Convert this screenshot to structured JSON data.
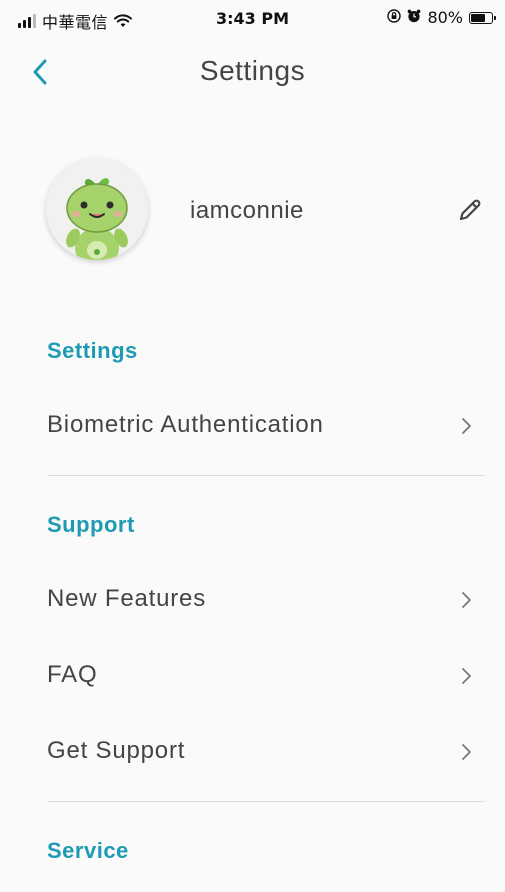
{
  "status_bar": {
    "carrier": "中華電信",
    "time": "3:43 PM",
    "battery_percent": "80%",
    "battery_level": 0.8,
    "icons": [
      "signal-icon",
      "wifi-icon",
      "orientation-lock-icon",
      "alarm-icon",
      "battery-icon"
    ]
  },
  "nav": {
    "title": "Settings",
    "back_icon": "chevron-left-icon"
  },
  "profile": {
    "username": "iamconnie",
    "avatar_icon": "green-mascot-avatar",
    "edit_icon": "pencil-icon"
  },
  "sections": {
    "settings": {
      "title": "Settings",
      "items": [
        {
          "label": "Biometric Authentication",
          "icon": "chevron-right-icon"
        }
      ]
    },
    "support": {
      "title": "Support",
      "items": [
        {
          "label": "New Features",
          "icon": "chevron-right-icon"
        },
        {
          "label": "FAQ",
          "icon": "chevron-right-icon"
        },
        {
          "label": "Get Support",
          "icon": "chevron-right-icon"
        }
      ]
    },
    "service": {
      "title": "Service"
    }
  },
  "colors": {
    "accent": "#1e9ab4",
    "text": "#444444",
    "background": "#fafafa",
    "divider": "#dedede"
  }
}
